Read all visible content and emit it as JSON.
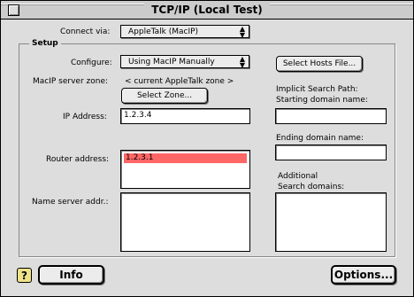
{
  "window": {
    "title": "TCP/IP (Local Test)"
  },
  "connect": {
    "label": "Connect via:",
    "value": "AppleTalk (MacIP)"
  },
  "setup": {
    "group_label": "Setup",
    "configure_label": "Configure:",
    "configure_value": "Using MacIP Manually",
    "server_zone_label": "MacIP server zone:",
    "server_zone_value": "< current AppleTalk zone >",
    "select_zone_button": "Select Zone...",
    "ip_label": "IP Address:",
    "ip_value": "1.2.3.4",
    "router_label": "Router address:",
    "router_value": "1.2.3.1",
    "nameserver_label": "Name server addr.:",
    "select_hosts_button": "Select Hosts File...",
    "implicit_search_label": "Implicit Search Path:",
    "starting_domain_label": "Starting domain name:",
    "ending_domain_label": "Ending domain name:",
    "additional_label_1": "Additional",
    "additional_label_2": "Search domains:"
  },
  "footer": {
    "help_icon": "?",
    "info_button": "Info",
    "options_button": "Options..."
  },
  "icons": {
    "close": "close-box-icon",
    "help": "help-icon",
    "popup": "popup-arrows-icon"
  },
  "colors": {
    "selection": "#ff6666",
    "window_bg": "#dddddd"
  }
}
